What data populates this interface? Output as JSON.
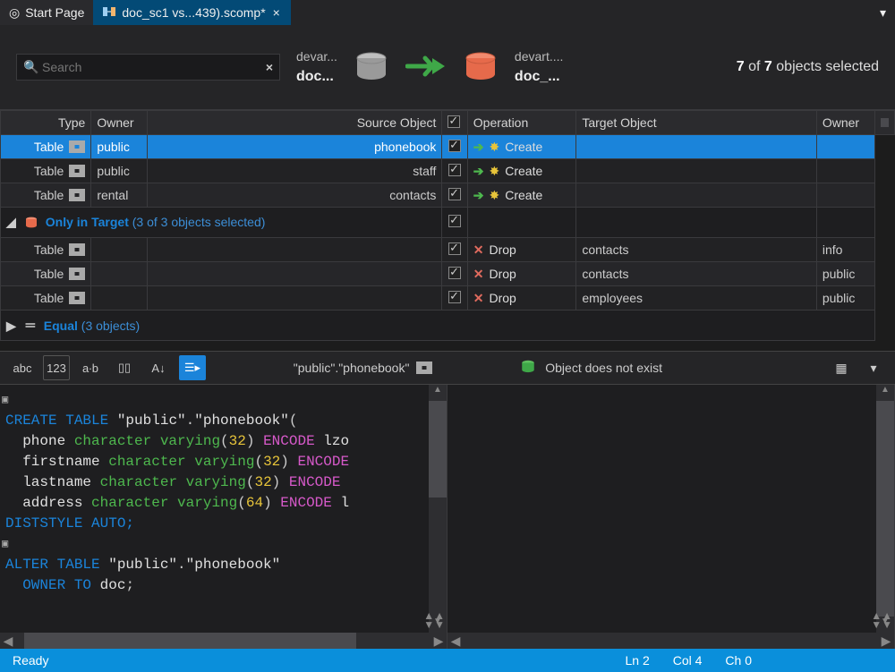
{
  "tabs": {
    "start": {
      "label": "Start Page"
    },
    "active": {
      "label": "doc_sc1 vs...439).scomp*"
    }
  },
  "search": {
    "placeholder": "Search"
  },
  "source_db": {
    "server": "devar...",
    "db": "doc..."
  },
  "target_db": {
    "server": "devart....",
    "db": "doc_..."
  },
  "summary": {
    "selected": "7",
    "total": "7",
    "suffix": "objects selected"
  },
  "columns": {
    "type": "Type",
    "owner": "Owner",
    "source": "Source Object",
    "operation": "Operation",
    "target": "Target Object",
    "owner2": "Owner"
  },
  "rows_source": [
    {
      "type": "Table",
      "owner": "public",
      "source": "phonebook",
      "op": "Create"
    },
    {
      "type": "Table",
      "owner": "public",
      "source": "staff",
      "op": "Create"
    },
    {
      "type": "Table",
      "owner": "rental",
      "source": "contacts",
      "op": "Create"
    }
  ],
  "group_target": {
    "label": "Only in Target",
    "count": "(3 of 3 objects selected)"
  },
  "rows_target": [
    {
      "type": "Table",
      "op": "Drop",
      "target": "contacts",
      "owner": "info"
    },
    {
      "type": "Table",
      "op": "Drop",
      "target": "contacts",
      "owner": "public"
    },
    {
      "type": "Table",
      "op": "Drop",
      "target": "employees",
      "owner": "public"
    }
  ],
  "group_equal": {
    "label": "Equal",
    "count": "(3 objects)"
  },
  "mid": {
    "source_label": "\"public\".\"phonebook\"",
    "target_msg": "Object does not exist"
  },
  "sql": {
    "l1a": "CREATE TABLE ",
    "l1b": "\"public\"",
    "l1c": ".",
    "l1d": "\"phonebook\"",
    "l1e": "(",
    "l2a": "  phone ",
    "l2b": "character varying",
    "l2c": "(",
    "l2d": "32",
    "l2e": ") ",
    "l2f": "ENCODE ",
    "l2g": "lzo",
    "l3a": "  firstname ",
    "l3b": "character varying",
    "l3c": "(",
    "l3d": "32",
    "l3e": ") ",
    "l3f": "ENCODE",
    "l4a": "  lastname ",
    "l4b": "character varying",
    "l4c": "(",
    "l4d": "32",
    "l4e": ") ",
    "l4f": "ENCODE ",
    "l5a": "  address ",
    "l5b": "character varying",
    "l5c": "(",
    "l5d": "64",
    "l5e": ") ",
    "l5f": "ENCODE ",
    "l5g": "l",
    "l6": "DISTSTYLE AUTO;",
    "l8a": "ALTER TABLE ",
    "l8b": "\"public\"",
    "l8c": ".",
    "l8d": "\"phonebook\"",
    "l9a": "  OWNER TO ",
    "l9b": "doc",
    "l9c": ";"
  },
  "status": {
    "ready": "Ready",
    "ln": "Ln 2",
    "col": "Col 4",
    "ch": "Ch 0"
  }
}
